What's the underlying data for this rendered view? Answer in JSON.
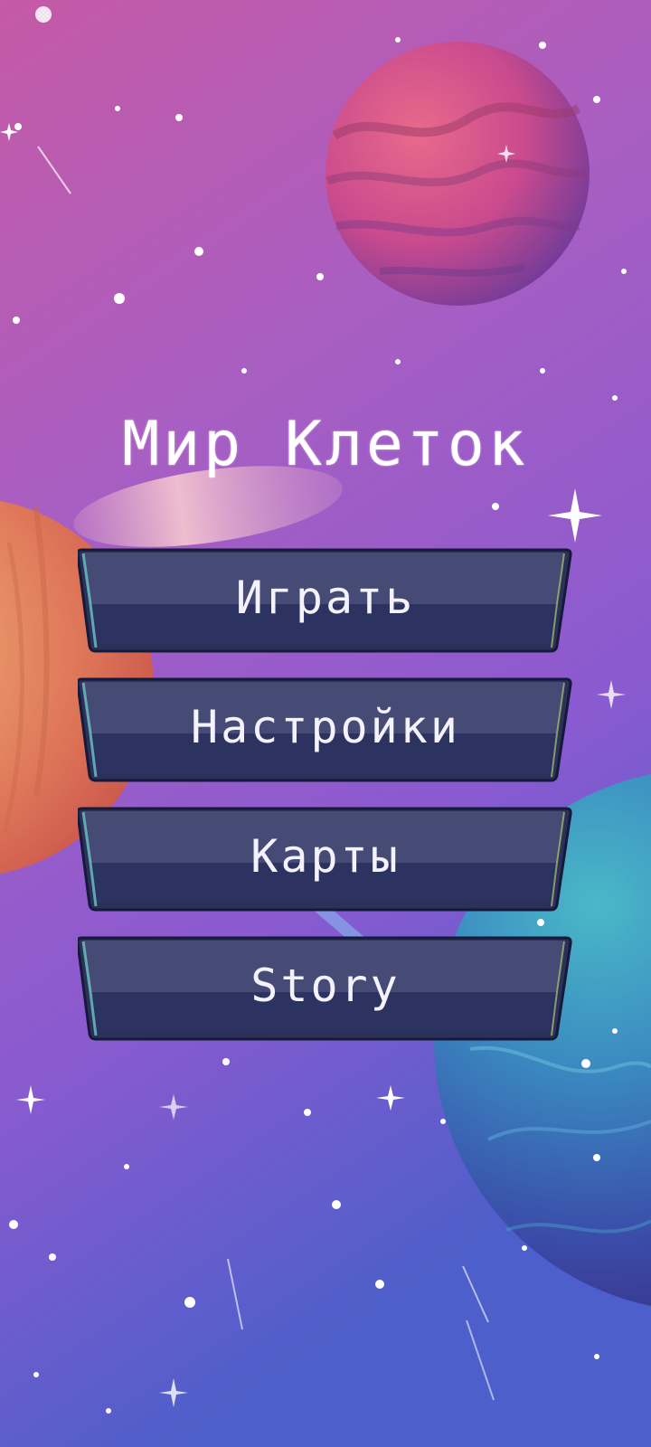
{
  "game": {
    "title": "Мир Клеток"
  },
  "menu": {
    "items": [
      {
        "id": "play",
        "label": "Играть"
      },
      {
        "id": "settings",
        "label": "Настройки"
      },
      {
        "id": "maps",
        "label": "Карты"
      },
      {
        "id": "story",
        "label": "Story"
      }
    ]
  },
  "colors": {
    "sky_top": "#c25aa8",
    "sky_mid": "#9a5ec8",
    "sky_bottom": "#4a5ec8",
    "button_top": "#444b72",
    "button_bottom": "#2a3058",
    "button_border": "#1a1e38",
    "button_rim": "#6ec7c6"
  }
}
